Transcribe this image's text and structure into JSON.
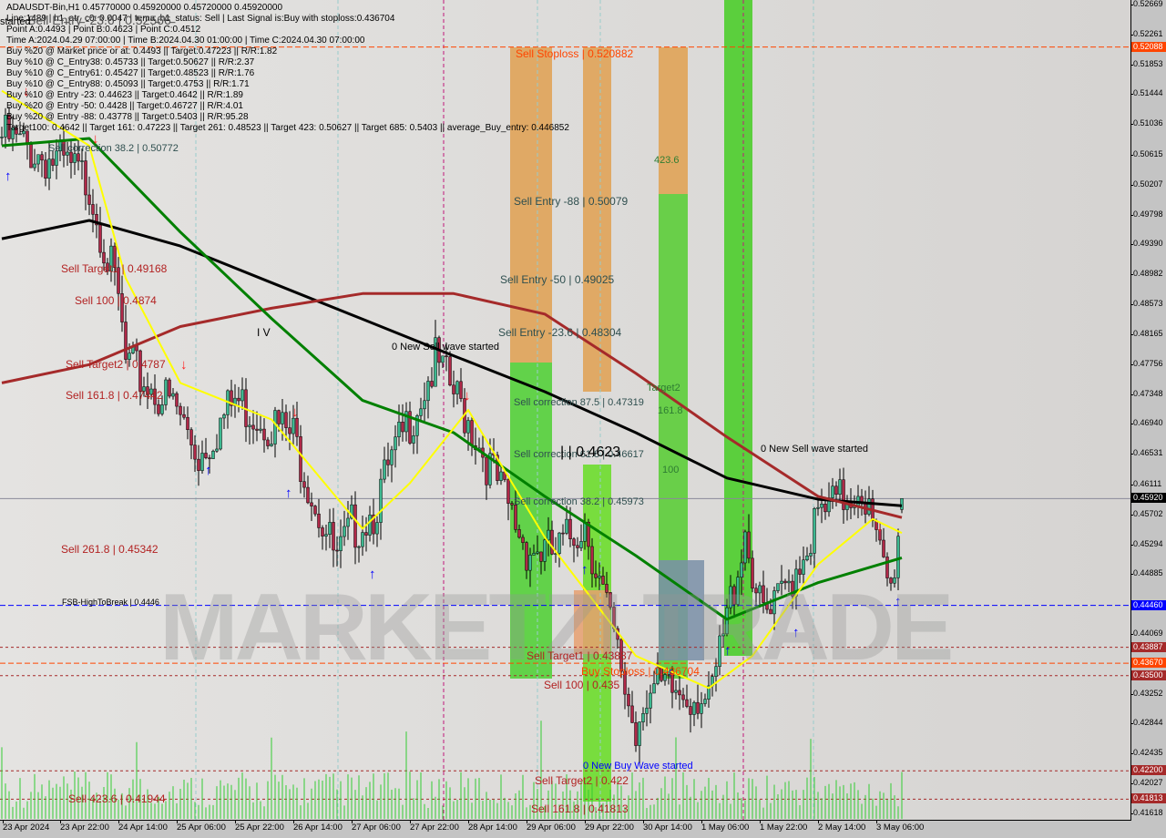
{
  "header": {
    "lines": [
      "ADAUSDT-Bin,H1  0.45770000 0.45920000 0.45720000 0.45920000",
      "Line:1489 | h1_atr_c0: 0.0047 | tema_h1_status: Sell | Last Signal is:Buy with stoploss:0.436704",
      "Point A:0.4493 | Point B:0.4623 | Point C:0.4512",
      "Time A:2024.04.29 07:00:00 | Time B:2024.04.30 01:00:00 | Time C:2024.04.30 07:00:00",
      "Buy %20 @ Market price or at: 0.4493 || Target:0.47223 || R/R:1.82",
      "Buy %10 @ C_Entry38: 0.45733 || Target:0.50627 || R/R:2.37",
      "Buy %10 @ C_Entry61: 0.45427 || Target:0.48523 || R/R:1.76",
      "Buy %10 @ C_Entry88: 0.45093 || Target:0.4753 || R/R:1.71",
      "Buy %10 @ Entry -23: 0.44623 || Target:0.4642 || R/R:1.89",
      "Buy %20 @ Entry -50: 0.4428 || Target:0.46727 || R/R:4.01",
      "Buy %20 @ Entry -88: 0.43778 || Target:0.5403 || R/R:95.28",
      "Target100: 0.4642 || Target 161: 0.47223 || Target 261: 0.48523 || Target 423: 0.50627 || Target 685: 0.5403 || average_Buy_entry: 0.446852"
    ]
  },
  "watermark": "MARKETZI TRADE",
  "annotations": [
    {
      "text": "Sell Stoploss | 0.520882",
      "color": "#ff4500"
    },
    {
      "text": "Sell Entry -88 | 0.50079",
      "color": "#2f4f4f"
    },
    {
      "text": "Sell Entry -50 | 0.49025",
      "color": "#2f4f4f"
    },
    {
      "text": "Sell Entry -23.6 | 0.48304",
      "color": "#2f4f4f"
    },
    {
      "text": "Sell correction 87.5 | 0.47319",
      "color": "#2f4f4f"
    },
    {
      "text": "Sell correction 61.8 | 0.46617",
      "color": "#2f4f4f"
    },
    {
      "text": "Sell correction 38.2 | 0.45973",
      "color": "#2f4f4f"
    },
    {
      "text": "| | 0.4623",
      "color": "#000000"
    },
    {
      "text": "Sell correction 38.2 | 0.50772",
      "color": "#2f4f4f"
    },
    {
      "text": "Sell Target1 | 0.49168",
      "color": "#b22222"
    },
    {
      "text": "Sell 100 | 0.4874",
      "color": "#b22222"
    },
    {
      "text": "Sell Target2 | 0.4787",
      "color": "#b22222"
    },
    {
      "text": "Sell 161.8 | 0.47442",
      "color": "#b22222"
    },
    {
      "text": "Sell 261.8 | 0.45342",
      "color": "#b22222"
    },
    {
      "text": "FSB-HighToBreak | 0.4446",
      "color": "#000000"
    },
    {
      "text": "Sell Target1 | 0.43887",
      "color": "#b22222"
    },
    {
      "text": "Buy Stoploss | 0.436704",
      "color": "#ff4500"
    },
    {
      "text": "Sell 100 | 0.435",
      "color": "#b22222"
    },
    {
      "text": "0 New Buy Wave started",
      "color": "#0000ff"
    },
    {
      "text": "Sell Target2 | 0.422",
      "color": "#b22222"
    },
    {
      "text": "Sell 161.8 | 0.41813",
      "color": "#b22222"
    },
    {
      "text": "Sell 423.6 | 0.41944",
      "color": "#b22222"
    },
    {
      "text": "0 New Sell wave started",
      "color": "#000000"
    },
    {
      "text": "0 New Sell wave started",
      "color": "#000000"
    },
    {
      "text": "423.6",
      "color": "#2e7d32"
    },
    {
      "text": "Target2",
      "color": "#2e7d32"
    },
    {
      "text": "161.8",
      "color": "#2e7d32"
    },
    {
      "text": "100",
      "color": "#2e7d32"
    },
    {
      "text": "I V",
      "color": "#000000"
    },
    {
      "text": "Sell Entry -23.6 | 0.52566",
      "color": "#555555"
    },
    {
      "text": "started",
      "color": "#000000"
    }
  ],
  "chart_data": {
    "type": "candlestick",
    "symbol": "ADAUSDT-Bin",
    "timeframe": "H1",
    "ylim": [
      0.41618,
      0.52669
    ],
    "close_path": [
      [
        "2024-04-23 06:00",
        0.5086
      ],
      [
        "2024-04-23 22:00",
        0.5049
      ],
      [
        "2024-04-24 06:00",
        0.5024
      ],
      [
        "2024-04-24 14:00",
        0.4862
      ],
      [
        "2024-04-24 16:00",
        0.4775
      ],
      [
        "2024-04-25 06:00",
        0.4713
      ],
      [
        "2024-04-25 12:00",
        0.4651
      ],
      [
        "2024-04-25 22:00",
        0.4726
      ],
      [
        "2024-04-26 14:00",
        0.4676
      ],
      [
        "2024-04-27 02:00",
        0.4502
      ],
      [
        "2024-04-27 06:00",
        0.4551
      ],
      [
        "2024-04-27 12:00",
        0.4576
      ],
      [
        "2024-04-27 22:00",
        0.4701
      ],
      [
        "2024-04-28 05:00",
        0.4777
      ],
      [
        "2024-04-28 14:00",
        0.4701
      ],
      [
        "2024-04-29 00:00",
        0.4589
      ],
      [
        "2024-04-29 06:00",
        0.4526
      ],
      [
        "2024-04-29 14:00",
        0.4514
      ],
      [
        "2024-04-29 22:00",
        0.4563
      ],
      [
        "2024-04-30 12:00",
        0.4272
      ],
      [
        "2024-04-30 14:00",
        0.4327
      ],
      [
        "2024-05-01 06:00",
        0.4327
      ],
      [
        "2024-05-01 08:00",
        0.4302
      ],
      [
        "2024-05-01 18:00",
        0.4551
      ],
      [
        "2024-05-01 22:00",
        0.4439
      ],
      [
        "2024-05-02 01:00",
        0.4427
      ],
      [
        "2024-05-02 14:00",
        0.4563
      ],
      [
        "2024-05-03 02:00",
        0.4613
      ],
      [
        "2024-05-03 06:00",
        0.4526
      ],
      [
        "2024-05-03 10:00",
        0.4464
      ],
      [
        "2024-05-03 13:00",
        0.4592
      ]
    ],
    "last_bar": {
      "open": 0.4577,
      "high": 0.4592,
      "low": 0.4572,
      "close": 0.4592
    },
    "series": [
      {
        "color": "#000000",
        "points": [
          [
            "2024-04-23 06:00",
            0.4947
          ],
          [
            "2024-04-24 06:00",
            0.4972
          ],
          [
            "2024-04-25 07:00",
            0.4937
          ],
          [
            "2024-04-26 08:00",
            0.4887
          ],
          [
            "2024-04-27 09:00",
            0.4837
          ],
          [
            "2024-04-28 10:00",
            0.4787
          ],
          [
            "2024-04-29 11:00",
            0.4738
          ],
          [
            "2024-04-30 12:00",
            0.4682
          ],
          [
            "2024-05-01 13:00",
            0.462
          ],
          [
            "2024-05-02 14:00",
            0.4591
          ],
          [
            "2024-05-03 13:00",
            0.4582
          ]
        ]
      },
      {
        "color": "#a52a2a",
        "points": [
          [
            "2024-04-23 06:00",
            0.475
          ],
          [
            "2024-04-24 06:00",
            0.4775
          ],
          [
            "2024-04-25 07:00",
            0.4827
          ],
          [
            "2024-04-26 08:00",
            0.4852
          ],
          [
            "2024-04-27 09:00",
            0.4872
          ],
          [
            "2024-04-28 10:00",
            0.4872
          ],
          [
            "2024-04-29 11:00",
            0.4844
          ],
          [
            "2024-04-30 12:00",
            0.4763
          ],
          [
            "2024-05-01 13:00",
            0.4676
          ],
          [
            "2024-05-02 14:00",
            0.4595
          ],
          [
            "2024-05-03 13:00",
            0.4566
          ]
        ]
      },
      {
        "color": "#008000",
        "points": [
          [
            "2024-04-23 06:00",
            0.5074
          ],
          [
            "2024-04-24 06:00",
            0.5084
          ],
          [
            "2024-04-25 07:00",
            0.4956
          ],
          [
            "2024-04-26 08:00",
            0.4838
          ],
          [
            "2024-04-27 09:00",
            0.4726
          ],
          [
            "2024-04-28 10:00",
            0.4682
          ],
          [
            "2024-04-29 11:00",
            0.4595
          ],
          [
            "2024-04-30 12:00",
            0.4514
          ],
          [
            "2024-05-01 13:00",
            0.4427
          ],
          [
            "2024-05-02 14:00",
            0.4477
          ],
          [
            "2024-05-03 13:00",
            0.4511
          ]
        ]
      },
      {
        "color": "#ffff00",
        "points": [
          [
            "2024-04-23 06:00",
            0.5149
          ],
          [
            "2024-04-24 06:00",
            0.5074
          ],
          [
            "2024-04-24 16:00",
            0.4893
          ],
          [
            "2024-04-25 07:00",
            0.475
          ],
          [
            "2024-04-26 08:00",
            0.47
          ],
          [
            "2024-04-27 09:00",
            0.4551
          ],
          [
            "2024-04-27 22:00",
            0.4613
          ],
          [
            "2024-04-28 14:00",
            0.4713
          ],
          [
            "2024-04-29 11:00",
            0.4539
          ],
          [
            "2024-04-30 12:00",
            0.4377
          ],
          [
            "2024-05-01 08:00",
            0.4333
          ],
          [
            "2024-05-01 20:00",
            0.4377
          ],
          [
            "2024-05-02 14:00",
            0.4502
          ],
          [
            "2024-05-03 05:00",
            0.4564
          ],
          [
            "2024-05-03 13:00",
            0.4545
          ]
        ]
      }
    ],
    "levels": [
      {
        "price": 0.52088,
        "label": "0.52088",
        "color": "#ff4500",
        "style": "dashed"
      },
      {
        "price": 0.4592,
        "label": "0.45920",
        "color": "#000000",
        "style": "solid"
      },
      {
        "price": 0.4446,
        "label": "0.44460",
        "color": "#0000ff",
        "style": "dashed"
      },
      {
        "price": 0.43887,
        "label": "0.43887",
        "color": "#a52a2a",
        "style": "dotted"
      },
      {
        "price": 0.4367,
        "label": "0.43670",
        "color": "#ff4500",
        "style": "dashed"
      },
      {
        "price": 0.435,
        "label": "0.43500",
        "color": "#a52a2a",
        "style": "dotted"
      },
      {
        "price": 0.422,
        "label": "0.42200",
        "color": "#a52a2a",
        "style": "dotted"
      },
      {
        "price": 0.41813,
        "label": "0.41813",
        "color": "#a52a2a",
        "style": "dotted"
      }
    ],
    "y_ticks": [
      "0.52669",
      "0.52261",
      "0.51853",
      "0.51444",
      "0.51036",
      "0.50615",
      "0.50207",
      "0.49798",
      "0.49390",
      "0.48982",
      "0.48573",
      "0.48165",
      "0.47756",
      "0.47348",
      "0.46940",
      "0.46531",
      "0.46111",
      "0.45702",
      "0.45294",
      "0.44885",
      "0.44069",
      "0.43252",
      "0.42844",
      "0.42435",
      "0.42027",
      "0.41618"
    ],
    "x_ticks": [
      "23 Apr 2024",
      "23 Apr 22:00",
      "24 Apr 14:00",
      "25 Apr 06:00",
      "25 Apr 22:00",
      "26 Apr 14:00",
      "27 Apr 06:00",
      "27 Apr 22:00",
      "28 Apr 14:00",
      "29 Apr 06:00",
      "29 Apr 22:00",
      "30 Apr 14:00",
      "1 May 06:00",
      "1 May 22:00",
      "2 May 14:00",
      "3 May 06:00"
    ]
  }
}
